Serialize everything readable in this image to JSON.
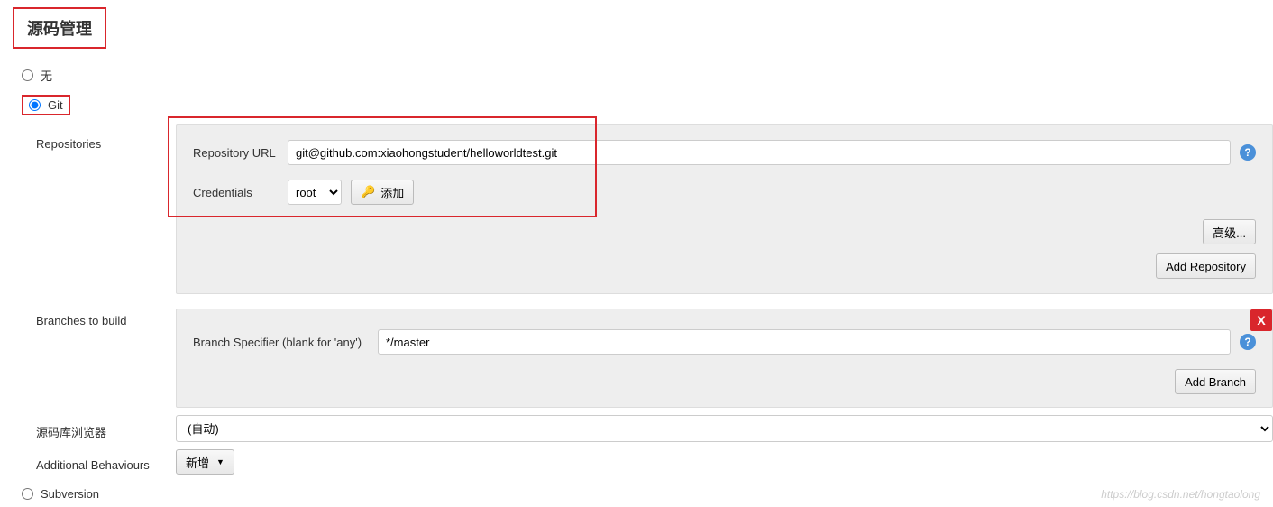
{
  "section_title": "源码管理",
  "scm": {
    "none_label": "无",
    "git_label": "Git",
    "subversion_label": "Subversion"
  },
  "repositories": {
    "label": "Repositories",
    "repo_url_label": "Repository URL",
    "repo_url_value": "git@github.com:xiaohongstudent/helloworldtest.git",
    "credentials_label": "Credentials",
    "credentials_value": "root",
    "add_credential_label": "添加",
    "advanced_label": "高级...",
    "add_repository_label": "Add Repository"
  },
  "branches": {
    "label": "Branches to build",
    "specifier_label": "Branch Specifier (blank for 'any')",
    "specifier_value": "*/master",
    "add_branch_label": "Add Branch",
    "delete_label": "X"
  },
  "repo_browser": {
    "label": "源码库浏览器",
    "value": "(自动)"
  },
  "additional": {
    "label": "Additional Behaviours",
    "add_label": "新增"
  },
  "watermark": "https://blog.csdn.net/hongtaolong"
}
